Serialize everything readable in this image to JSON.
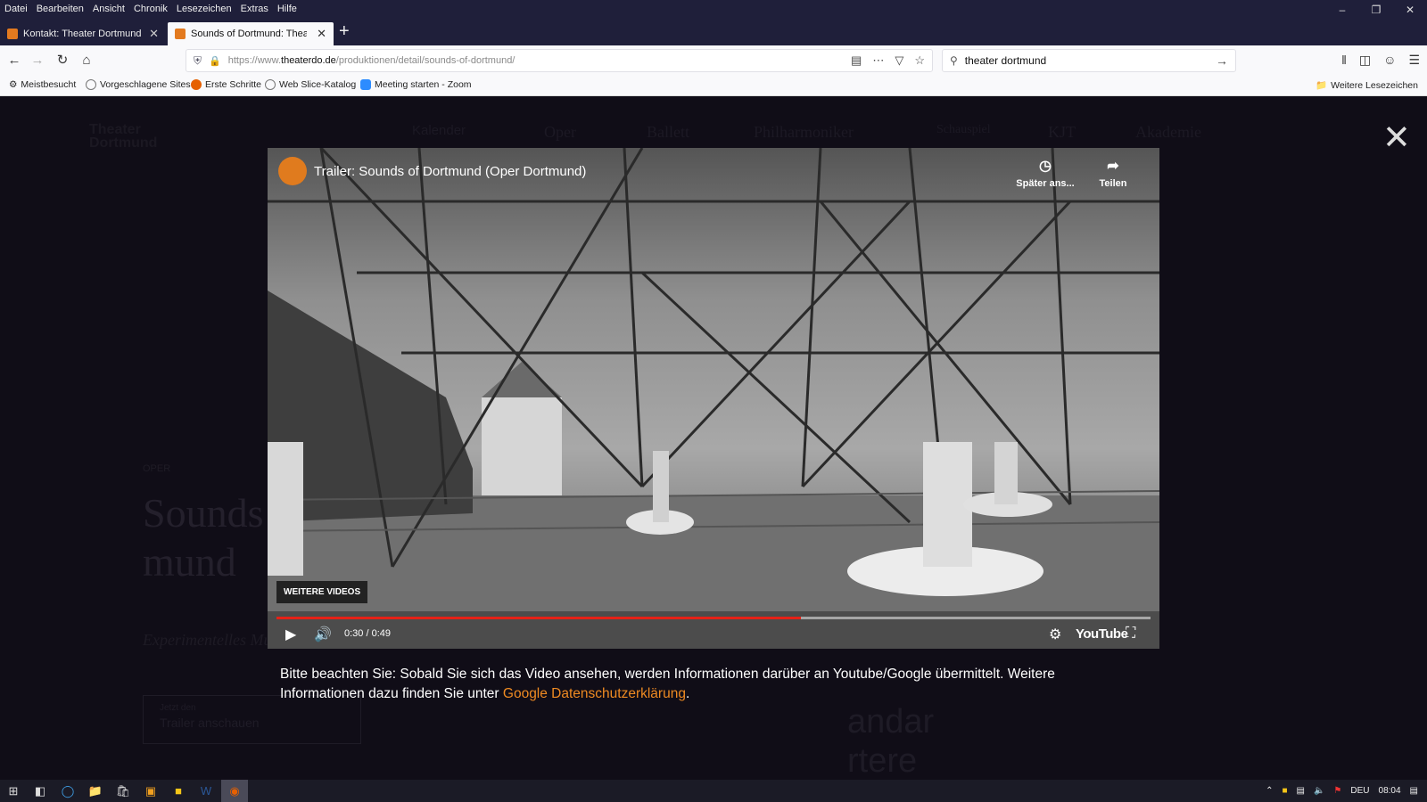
{
  "menu": [
    "Datei",
    "Bearbeiten",
    "Ansicht",
    "Chronik",
    "Lesezeichen",
    "Extras",
    "Hilfe"
  ],
  "tabs": [
    {
      "title": "Kontakt: Theater Dortmund",
      "active": false
    },
    {
      "title": "Sounds of Dortmund: Theater",
      "active": true
    }
  ],
  "url": {
    "prefix": "https://www.",
    "domain": "theaterdo.de",
    "path": "/produktionen/detail/sounds-of-dortmund/"
  },
  "search": {
    "value": "theater dortmund"
  },
  "bookmarks": [
    "Meistbesucht",
    "Vorgeschlagene Sites",
    "Erste Schritte",
    "Web Slice-Katalog",
    "Meeting starten - Zoom"
  ],
  "bookmarks_right": "Weitere Lesezeichen",
  "site_nav": [
    "Kalender",
    "Oper",
    "Ballett",
    "Philharmoniker",
    "Schauspiel",
    "KJT",
    "Akademie"
  ],
  "site_logo": [
    "Theater",
    "Dortmund"
  ],
  "background": {
    "kicker": "OPER",
    "title_line1": "Sounds",
    "title_line2": "mund",
    "subtitle": "Experimentelles Musiktheater",
    "button_small": "Jetzt den",
    "button_label": "Trailer anschauen",
    "side_line1": "andar",
    "side_line2": "rtere"
  },
  "video": {
    "title": "Trailer: Sounds of Dortmund (Oper Dortmund)",
    "watch_later": "Später ans...",
    "share": "Teilen",
    "more_videos": "WEITERE VIDEOS",
    "time": "0:30 / 0:49",
    "progress": 0.6,
    "brand": "YouTube"
  },
  "notice": {
    "text": "Bitte beachten Sie: Sobald Sie sich das Video ansehen, werden Informationen darüber an Youtube/Google übermittelt. Weitere Informationen dazu finden Sie unter ",
    "link": "Google Datenschutzerklärung",
    "end": "."
  },
  "tray": {
    "lang": "DEU",
    "time": "08:04"
  },
  "colors": {
    "accent": "#ee8a22",
    "progress": "#e62117"
  }
}
